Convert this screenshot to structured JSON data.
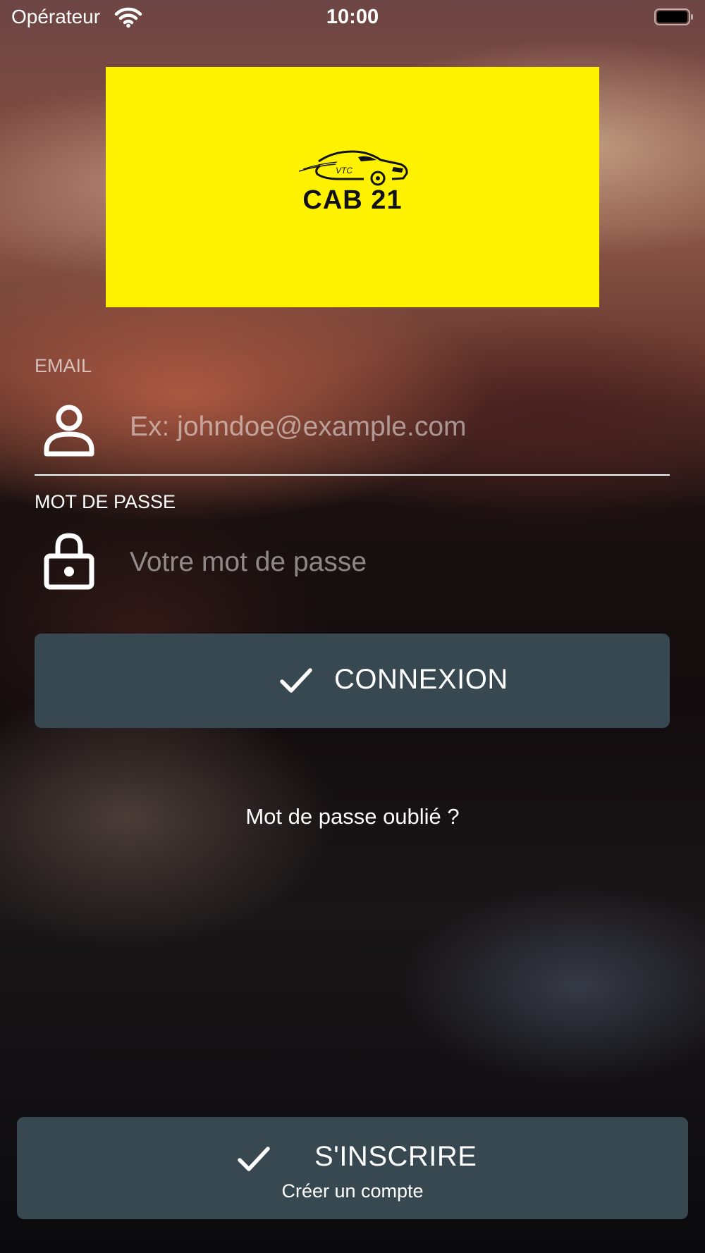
{
  "status_bar": {
    "carrier": "Opérateur",
    "time": "10:00",
    "wifi_icon": "wifi-icon",
    "battery_icon": "battery-icon"
  },
  "logo": {
    "text": "CAB 21",
    "badge": "VTC",
    "background_color": "#fff200",
    "icon": "car-icon"
  },
  "email": {
    "label": "EMAIL",
    "placeholder": "Ex: johndoe@example.com",
    "value": "",
    "icon": "user-icon"
  },
  "password": {
    "label": "MOT DE PASSE",
    "placeholder": "Votre mot de passe",
    "value": "",
    "icon": "lock-icon"
  },
  "login_button": {
    "label": "CONNEXION",
    "icon": "check-icon",
    "color": "#374850"
  },
  "forgot_link": "Mot de passe oublié ?",
  "signup_button": {
    "label": "S'INSCRIRE",
    "sublabel": "Créer un compte",
    "icon": "check-icon",
    "color": "#374850"
  }
}
